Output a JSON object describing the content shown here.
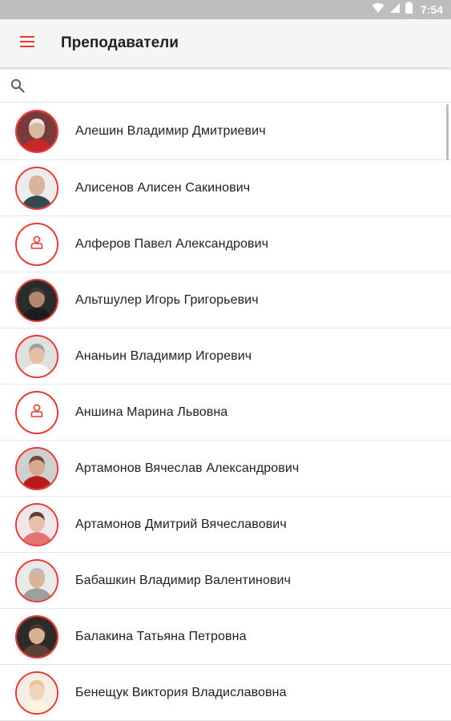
{
  "status_bar": {
    "time": "7:54"
  },
  "app_bar": {
    "title": "Преподаватели",
    "menu_icon": "hamburger-menu-icon"
  },
  "search": {
    "placeholder": "",
    "value": "",
    "icon": "search-icon"
  },
  "accent_color": "#e53935",
  "teachers": [
    {
      "name": "Алешин Владимир Дмитриевич",
      "avatar": "photo",
      "photo": {
        "bg": "#7a3a3a",
        "skin": "#d9b8a0",
        "hair": "#e8e8e8",
        "shirt": "#c62828"
      }
    },
    {
      "name": "Алисенов Алисен Сакинович",
      "avatar": "photo",
      "photo": {
        "bg": "#ececec",
        "skin": "#d8b49a",
        "hair": "#d8b49a",
        "shirt": "#37474f"
      }
    },
    {
      "name": "Алферов Павел Александрович",
      "avatar": "placeholder"
    },
    {
      "name": "Альтшулер Игорь Григорьевич",
      "avatar": "photo",
      "photo": {
        "bg": "#2b2b2b",
        "skin": "#b08870",
        "hair": "#3a3a3a",
        "shirt": "#1c1c1c"
      }
    },
    {
      "name": "Ананьин Владимир Игоревич",
      "avatar": "photo",
      "photo": {
        "bg": "#e0e0e0",
        "skin": "#e2bfa5",
        "hair": "#9e9e9e",
        "shirt": "#fafafa"
      }
    },
    {
      "name": "Аншина Марина Львовна",
      "avatar": "placeholder"
    },
    {
      "name": "Артамонов Вячеслав Александрович",
      "avatar": "photo",
      "photo": {
        "bg": "#cfcfcf",
        "skin": "#d9a98c",
        "hair": "#6d4c41",
        "shirt": "#b71c1c"
      }
    },
    {
      "name": "Артамонов Дмитрий Вячеславович",
      "avatar": "photo",
      "photo": {
        "bg": "#f1e7ea",
        "skin": "#e6c0a8",
        "hair": "#5d4037",
        "shirt": "#e57373"
      }
    },
    {
      "name": "Бабашкин Владимир Валентинович",
      "avatar": "photo",
      "photo": {
        "bg": "#eaeaea",
        "skin": "#d8b49a",
        "hair": "#bdbdbd",
        "shirt": "#9e9e9e"
      }
    },
    {
      "name": "Балакина Татьяна Петровна",
      "avatar": "photo",
      "photo": {
        "bg": "#2e2a28",
        "skin": "#d7b295",
        "hair": "#4e342e",
        "shirt": "#5d4037"
      }
    },
    {
      "name": "Бенещук Виктория Владиславовна",
      "avatar": "photo",
      "photo": {
        "bg": "#f3efe6",
        "skin": "#f0d3bd",
        "hair": "#e7c98e",
        "shirt": "#fff3e0"
      }
    }
  ]
}
